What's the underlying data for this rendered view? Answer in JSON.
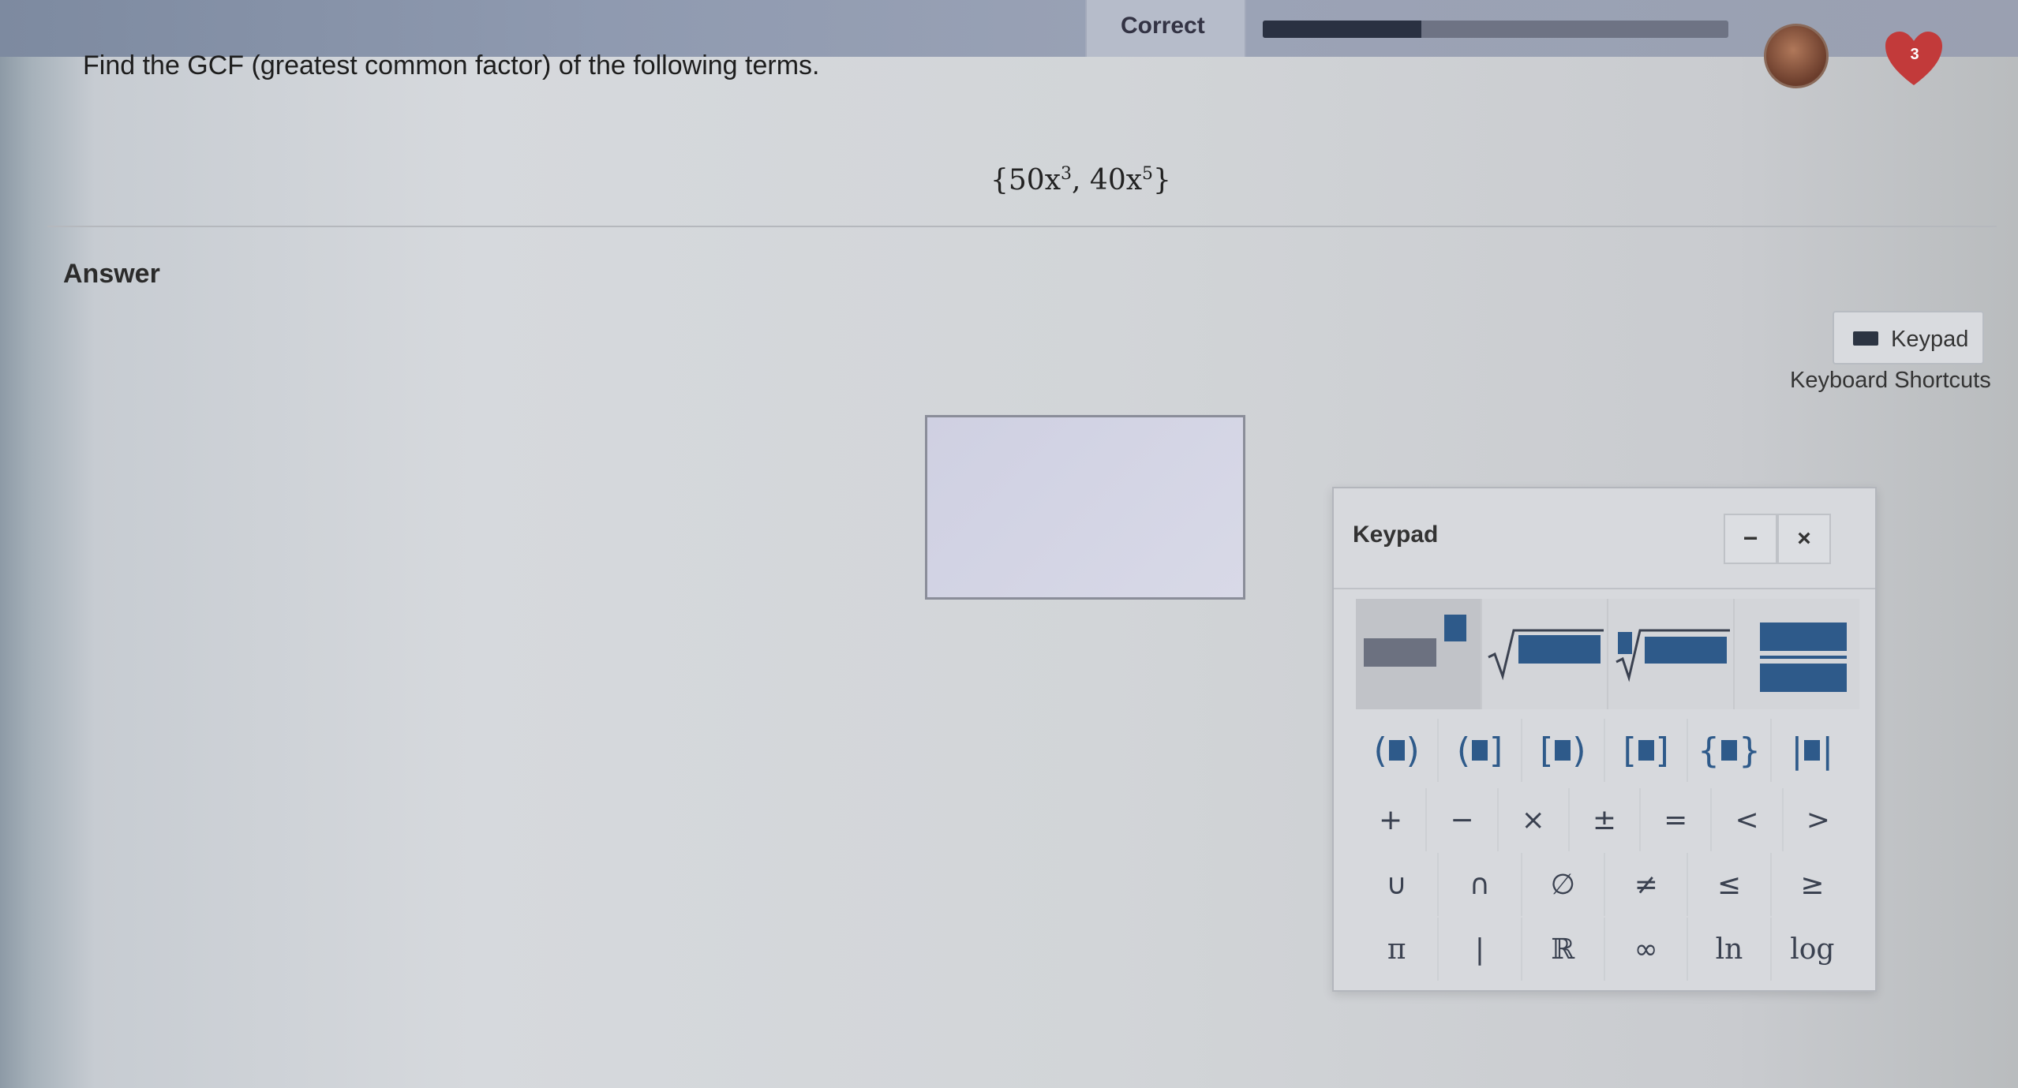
{
  "header": {
    "status_label": "Correct",
    "progress_fraction": 0.34,
    "lives": "3"
  },
  "question": {
    "prompt": "Find the GCF (greatest common factor) of the following terms.",
    "expression": {
      "open": "{",
      "term1_coef": "50x",
      "term1_exp": "3",
      "separator": ", ",
      "term2_coef": "40x",
      "term2_exp": "5",
      "close": "}"
    }
  },
  "answer": {
    "label": "Answer",
    "input_value": ""
  },
  "controls": {
    "keypad_toggle_label": "Keypad",
    "shortcuts_link": "Keyboard Shortcuts"
  },
  "keypad": {
    "title": "Keypad",
    "minimize_label": "−",
    "close_label": "×",
    "templates": [
      "exponent",
      "square-root",
      "nth-root",
      "fraction"
    ],
    "bracket_row": [
      {
        "name": "paren-paren",
        "open": "(",
        "close": ")"
      },
      {
        "name": "paren-bracket",
        "open": "(",
        "close": "]"
      },
      {
        "name": "bracket-paren",
        "open": "[",
        "close": ")"
      },
      {
        "name": "bracket-bracket",
        "open": "[",
        "close": "]"
      },
      {
        "name": "brace-brace",
        "open": "{",
        "close": "}"
      },
      {
        "name": "abs-value",
        "open": "|",
        "close": "|"
      }
    ],
    "operator_row": [
      "+",
      "−",
      "×",
      "±",
      "=",
      "<",
      ">"
    ],
    "set_row": [
      "∪",
      "∩",
      "∅",
      "≠",
      "≤",
      "≥"
    ],
    "misc_row": [
      "π",
      "|",
      "ℝ",
      "∞",
      "ln",
      "log"
    ]
  },
  "colors": {
    "accent_blue": "#2e5a8a",
    "heart_red": "#c23a3a"
  }
}
